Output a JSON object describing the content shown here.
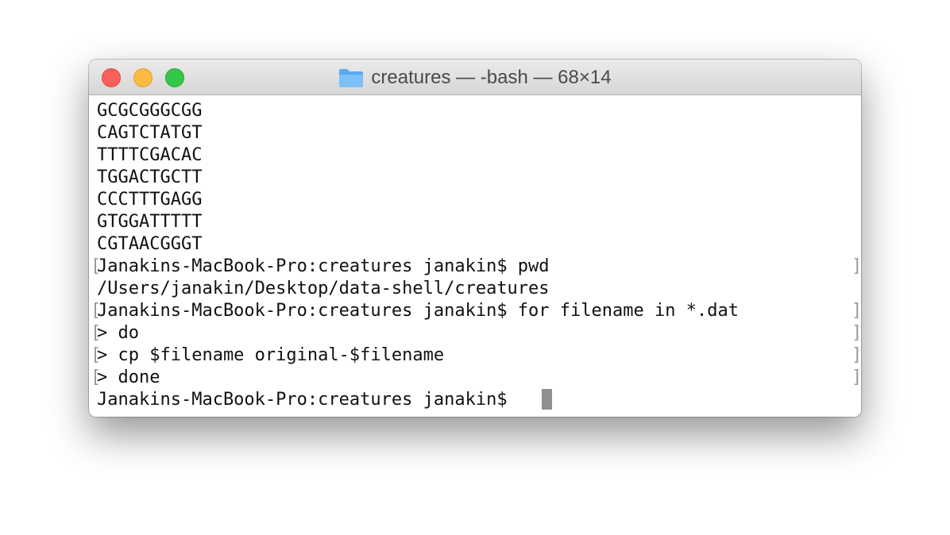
{
  "window": {
    "title": "creatures — -bash — 68×14",
    "folder_icon": "folder-icon",
    "folder_color": "#6cb3f5"
  },
  "terminal": {
    "lines": [
      {
        "text": "GCGCGGGCGG",
        "marked": false
      },
      {
        "text": "CAGTCTATGT",
        "marked": false
      },
      {
        "text": "TTTTCGACAC",
        "marked": false
      },
      {
        "text": "TGGACTGCTT",
        "marked": false
      },
      {
        "text": "CCCTTTGAGG",
        "marked": false
      },
      {
        "text": "GTGGATTTTT",
        "marked": false
      },
      {
        "text": "CGTAACGGGT",
        "marked": false
      },
      {
        "text": "Janakins-MacBook-Pro:creatures janakin$ pwd",
        "marked": true
      },
      {
        "text": "/Users/janakin/Desktop/data-shell/creatures",
        "marked": false
      },
      {
        "text": "Janakins-MacBook-Pro:creatures janakin$ for filename in *.dat",
        "marked": true
      },
      {
        "text": "> do",
        "marked": true
      },
      {
        "text": "> cp $filename original-$filename",
        "marked": true
      },
      {
        "text": "> done",
        "marked": true
      },
      {
        "text": "Janakins-MacBook-Pro:creatures janakin$ ",
        "marked": false
      }
    ],
    "mark_open": "[",
    "mark_close": "]",
    "cursor_color": "#8f8f8f"
  }
}
